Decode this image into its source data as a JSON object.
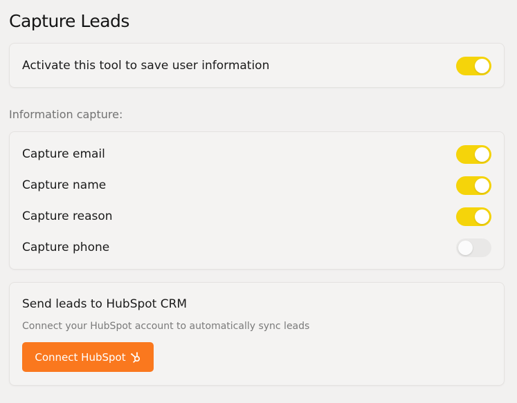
{
  "page": {
    "title": "Capture Leads"
  },
  "activate": {
    "label": "Activate this tool to save user information",
    "enabled": true
  },
  "capture": {
    "section_label": "Information capture:",
    "items": [
      {
        "label": "Capture email",
        "enabled": true
      },
      {
        "label": "Capture name",
        "enabled": true
      },
      {
        "label": "Capture reason",
        "enabled": true
      },
      {
        "label": "Capture phone",
        "enabled": false
      }
    ]
  },
  "hubspot": {
    "title": "Send leads to HubSpot CRM",
    "description": "Connect your HubSpot account to automatically sync leads",
    "button_label": "Connect HubSpot",
    "button_icon": "hubspot-icon"
  },
  "colors": {
    "toggle_on": "#f5d40a",
    "toggle_off": "#e9e8e7",
    "brand_button": "#fa781e"
  }
}
